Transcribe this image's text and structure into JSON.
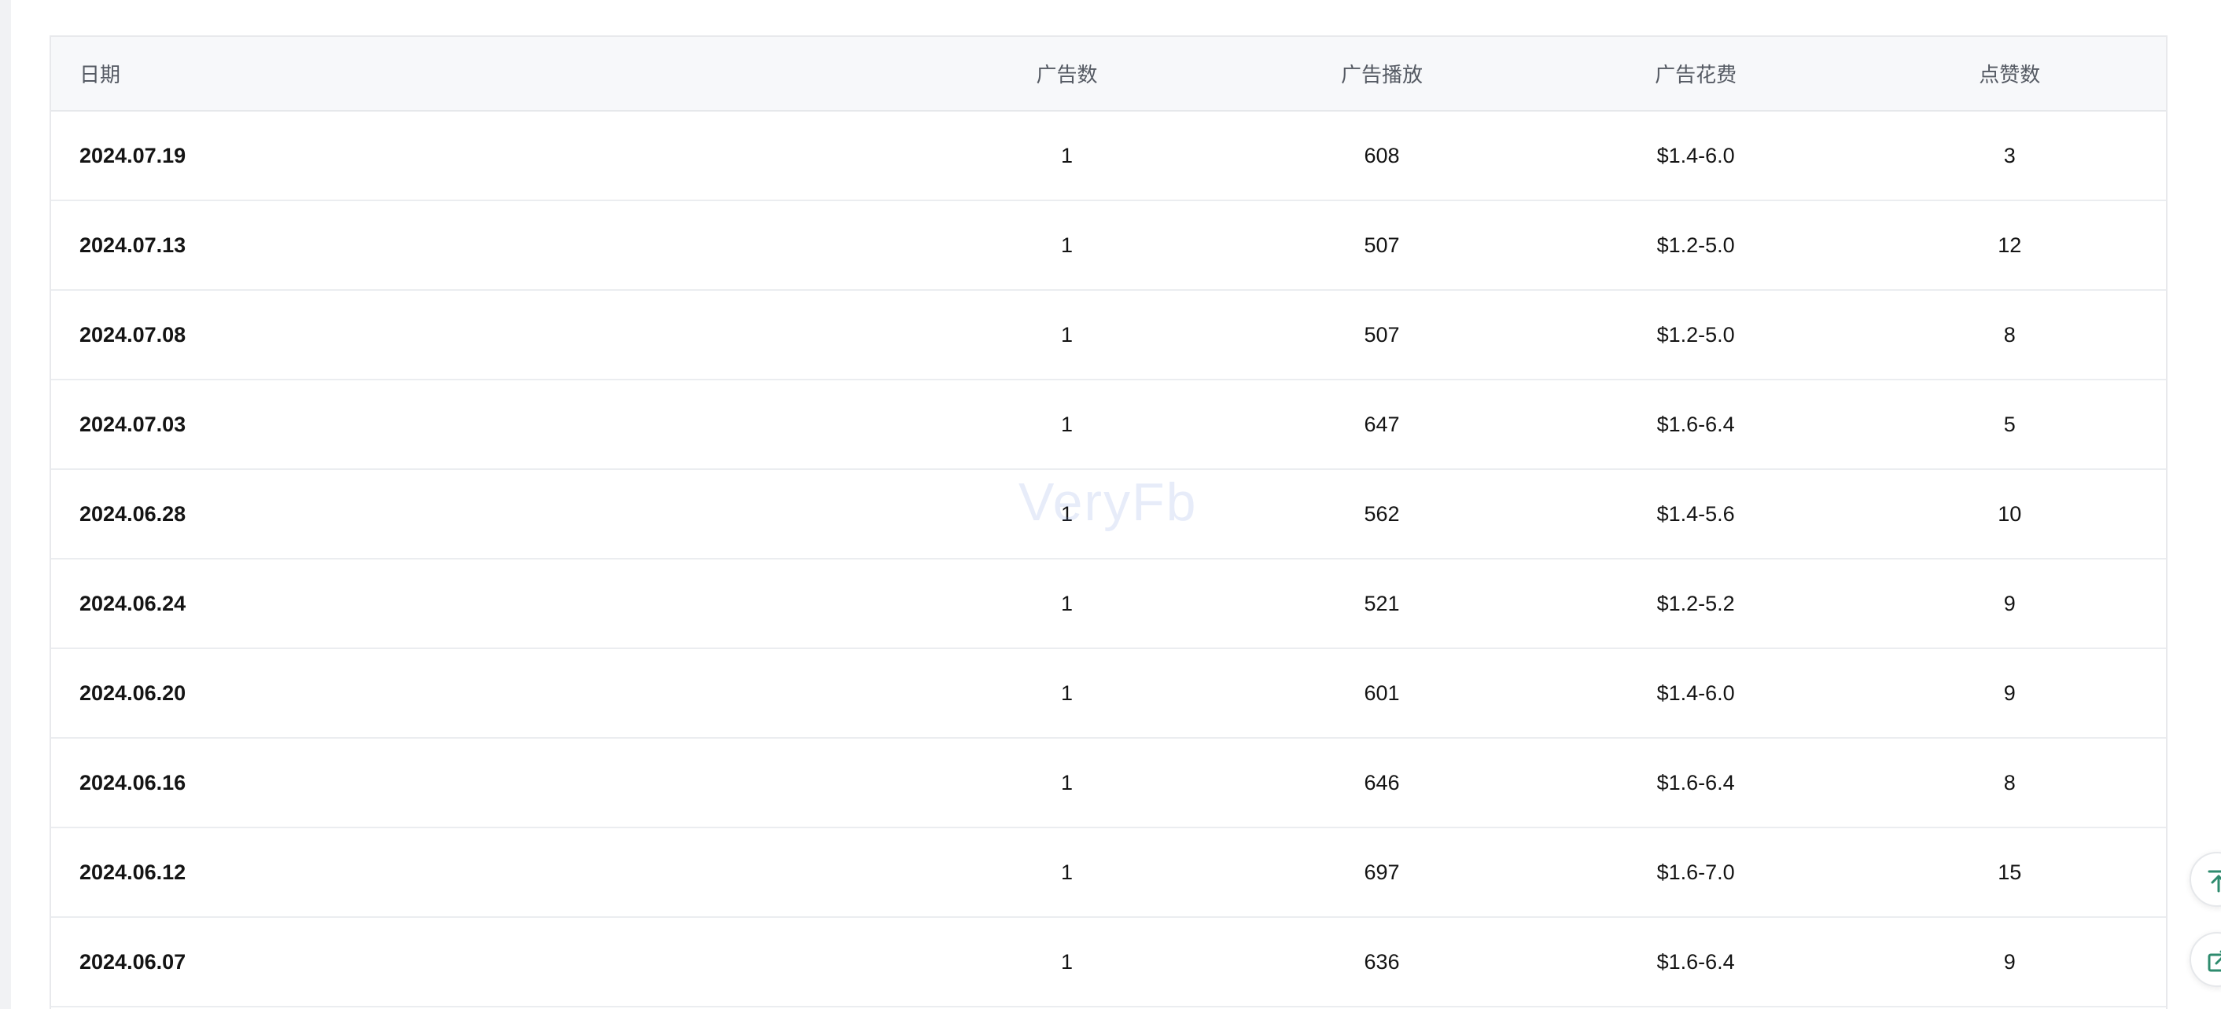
{
  "table": {
    "headers": {
      "date": "日期",
      "ad_count": "广告数",
      "ad_plays": "广告播放",
      "ad_cost": "广告花费",
      "likes": "点赞数"
    },
    "rows": [
      {
        "date": "2024.07.19",
        "ad_count": "1",
        "ad_plays": "608",
        "ad_cost": "$1.4-6.0",
        "likes": "3"
      },
      {
        "date": "2024.07.13",
        "ad_count": "1",
        "ad_plays": "507",
        "ad_cost": "$1.2-5.0",
        "likes": "12"
      },
      {
        "date": "2024.07.08",
        "ad_count": "1",
        "ad_plays": "507",
        "ad_cost": "$1.2-5.0",
        "likes": "8"
      },
      {
        "date": "2024.07.03",
        "ad_count": "1",
        "ad_plays": "647",
        "ad_cost": "$1.6-6.4",
        "likes": "5"
      },
      {
        "date": "2024.06.28",
        "ad_count": "1",
        "ad_plays": "562",
        "ad_cost": "$1.4-5.6",
        "likes": "10"
      },
      {
        "date": "2024.06.24",
        "ad_count": "1",
        "ad_plays": "521",
        "ad_cost": "$1.2-5.2",
        "likes": "9"
      },
      {
        "date": "2024.06.20",
        "ad_count": "1",
        "ad_plays": "601",
        "ad_cost": "$1.4-6.0",
        "likes": "9"
      },
      {
        "date": "2024.06.16",
        "ad_count": "1",
        "ad_plays": "646",
        "ad_cost": "$1.6-6.4",
        "likes": "8"
      },
      {
        "date": "2024.06.12",
        "ad_count": "1",
        "ad_plays": "697",
        "ad_cost": "$1.6-7.0",
        "likes": "15"
      },
      {
        "date": "2024.06.07",
        "ad_count": "1",
        "ad_plays": "636",
        "ad_cost": "$1.6-6.4",
        "likes": "9"
      }
    ]
  },
  "watermark": "VeryFb",
  "float_buttons": {
    "back_to_top_icon": "arrow-up-to-top-icon",
    "share_icon": "external-share-icon",
    "accent_color": "#2e8b6e"
  }
}
